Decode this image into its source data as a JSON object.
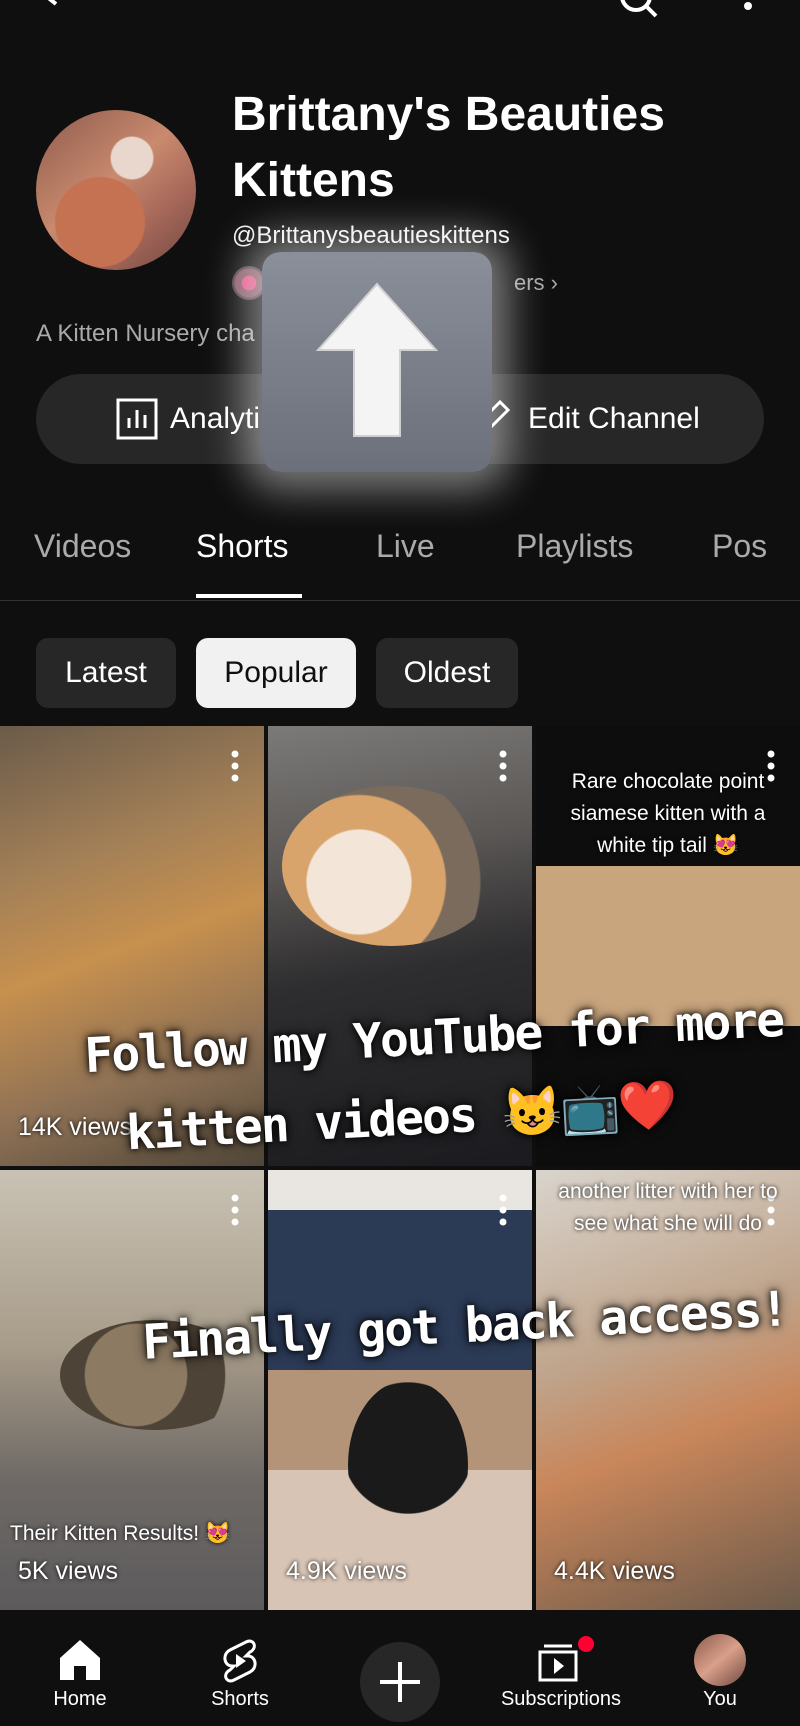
{
  "channel": {
    "title": "Brittany's Beauties Kittens",
    "handle": "@Brittanysbeautieskittens",
    "subscribers_visible": "ers ›",
    "description": "A Kitten Nursery cha"
  },
  "actions": {
    "analytics_label": "Analyti",
    "edit_label": "Edit Channel"
  },
  "tabs": [
    {
      "label": "Videos"
    },
    {
      "label": "Shorts",
      "active": true
    },
    {
      "label": "Live"
    },
    {
      "label": "Playlists"
    },
    {
      "label": "Pos"
    }
  ],
  "chips": [
    {
      "label": "Latest"
    },
    {
      "label": "Popular",
      "selected": true
    },
    {
      "label": "Oldest"
    }
  ],
  "shorts": [
    {
      "views": "14K views",
      "caption_top": "",
      "caption_bottom": ""
    },
    {
      "views": "",
      "caption_top": "",
      "caption_bottom": ""
    },
    {
      "views": "",
      "caption_top": "Rare chocolate point siamese kitten with a white tip tail 😻",
      "caption_bottom": ""
    },
    {
      "views": "5K views",
      "caption_top": "",
      "caption_bottom": "Their Kitten Results! 😻"
    },
    {
      "views": "4.9K views",
      "caption_top": "",
      "caption_bottom": ""
    },
    {
      "views": "4.4K views",
      "caption_top": "another litter with her to see what she will do",
      "caption_bottom": ""
    }
  ],
  "overlay_text": {
    "line1": "Follow my YouTube for more",
    "line2": "kitten videos 😺📺❤️",
    "line3": "Finally got back access!"
  },
  "bottom_nav": {
    "home": "Home",
    "shorts": "Shorts",
    "subscriptions": "Subscriptions",
    "you": "You"
  },
  "colors": {
    "background": "#0f0f0f",
    "chip": "#272727",
    "selected_chip": "#f1f1f1",
    "notification": "#ff0033"
  }
}
